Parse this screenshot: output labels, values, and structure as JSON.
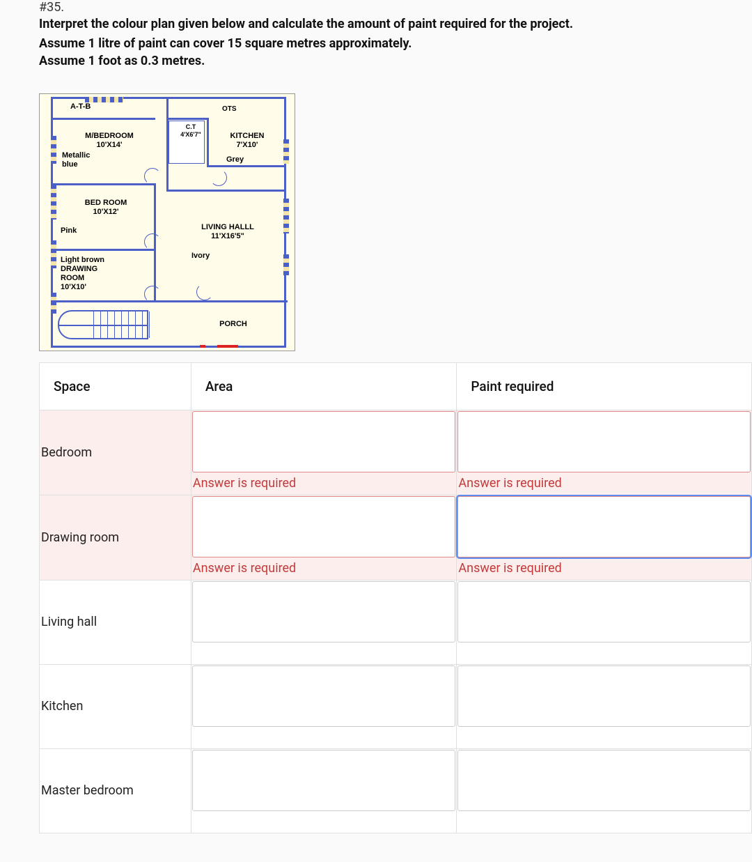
{
  "question_number": "#35.",
  "prompt_line1": "Interpret the colour plan given below and calculate the amount of paint required for the project.",
  "prompt_line2": "Assume 1 litre of paint can cover 15 square metres approximately.",
  "prompt_line3": "Assume 1 foot as 0.3 metres.",
  "floor_plan": {
    "atb": "A-T-B",
    "ots": "OTS",
    "ct_label": "C.T",
    "ct_dim": "4'X6'7\"",
    "kitchen_label": "KITCHEN",
    "kitchen_dim": "7'X10'",
    "kitchen_colour": "Grey",
    "mbed_label": "M/BEDROOM",
    "mbed_dim": "10'X14'",
    "mbed_colour": "Metallic",
    "mbed_colour2": "blue",
    "bed_label": "BED ROOM",
    "bed_dim": "10'X12'",
    "bed_colour": "Pink",
    "living_label": "LIVING HALLL",
    "living_dim": "11'X16'5\"",
    "living_colour": "Ivory",
    "drawing_colour": "Light brown",
    "drawing_label": "DRAWING",
    "drawing_label2": "ROOM",
    "drawing_dim": "10'X10'",
    "porch_label": "PORCH"
  },
  "table": {
    "headers": {
      "space": "Space",
      "area": "Area",
      "paint": "Paint required"
    },
    "error_msg": "Answer is required",
    "rows": [
      {
        "space": "Bedroom",
        "error": true,
        "area": "",
        "paint": ""
      },
      {
        "space": "Drawing room",
        "error": true,
        "area": "",
        "paint": "",
        "paint_focused": true
      },
      {
        "space": "Living hall",
        "error": false,
        "area": "",
        "paint": ""
      },
      {
        "space": "Kitchen",
        "error": false,
        "area": "",
        "paint": ""
      },
      {
        "space": "Master bedroom",
        "error": false,
        "area": "",
        "paint": ""
      }
    ]
  }
}
